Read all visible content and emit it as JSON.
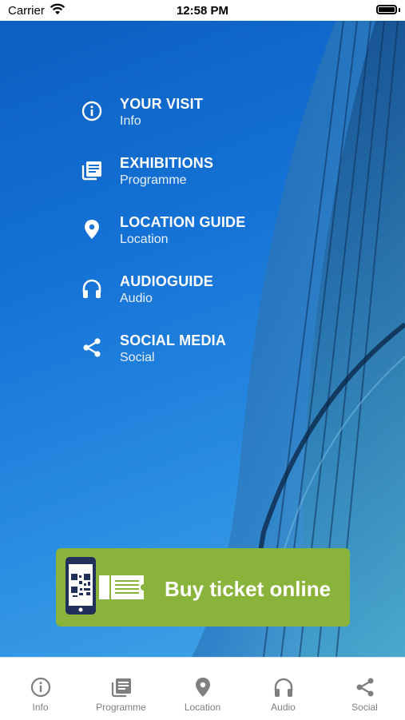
{
  "status_bar": {
    "carrier": "Carrier",
    "time": "12:58 PM"
  },
  "menu": [
    {
      "title": "YOUR VISIT",
      "subtitle": "Info",
      "icon": "info-icon"
    },
    {
      "title": "EXHIBITIONS",
      "subtitle": "Programme",
      "icon": "newspaper-icon"
    },
    {
      "title": "LOCATION GUIDE",
      "subtitle": "Location",
      "icon": "location-pin-icon"
    },
    {
      "title": "AUDIOGUIDE",
      "subtitle": "Audio",
      "icon": "headphones-icon"
    },
    {
      "title": "SOCIAL MEDIA",
      "subtitle": "Social",
      "icon": "share-icon"
    }
  ],
  "ticket_banner": {
    "label": "Buy ticket online",
    "background": "#8ab33c"
  },
  "tab_bar": {
    "tabs": [
      {
        "label": "Info",
        "icon": "info-icon"
      },
      {
        "label": "Programme",
        "icon": "newspaper-icon"
      },
      {
        "label": "Location",
        "icon": "location-pin-icon"
      },
      {
        "label": "Audio",
        "icon": "headphones-icon"
      },
      {
        "label": "Social",
        "icon": "share-icon"
      }
    ]
  },
  "colors": {
    "hero_blue": "#1572d6",
    "tab_gray": "#7f7f7f",
    "ticket_green": "#8ab33c"
  }
}
